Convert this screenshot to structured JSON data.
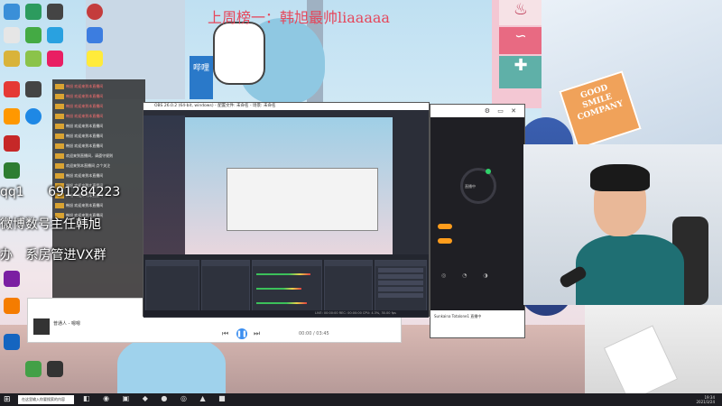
{
  "banner": "上周榜一：韩旭最帅liaaaaa",
  "overlay": {
    "qq_prefix": "qq1",
    "qq_number": "691284223",
    "wechat_line": "微博",
    "wechat_suffix": "数号主任韩旭",
    "office_line": "办",
    "office_suffix": "系房管进VX群"
  },
  "obs": {
    "title": "OBS 26.0.2 (64-bit, windows) - 配置文件: 未命名 - 场景: 未命名",
    "status": "LIVE: 00:00:00  REC: 00:00:00  CPU: 4.3%, 30.00 fps"
  },
  "tool": {
    "ring_label": "直播中",
    "footer_text": "Sunkaina  Totalone1 直播中"
  },
  "music": {
    "title": "普通人 - 嗯嗯",
    "time": "00:00 / 03:45"
  },
  "smile_sign": [
    "GOOD",
    "SMILE",
    "COMPANY"
  ],
  "signs": {
    "bili": "哔哩",
    "fan": "♨",
    "whale": "∽",
    "plus": "✚"
  },
  "taskbar": {
    "search_placeholder": "在这里输入你要搜索的内容",
    "start_glyph": "⊞",
    "icons": "◧ ◉ ▣ ◆ ● ◎ ▲ ■",
    "tray_line1": "19:34",
    "tray_line2": "2021/3/24"
  },
  "chat": {
    "lines": [
      {
        "text": "韩旭 欢迎来到本直播间",
        "red": true
      },
      {
        "text": "韩旭 欢迎来到本直播间",
        "red": true
      },
      {
        "text": "韩旭 欢迎来到本直播间",
        "red": true
      },
      {
        "text": "韩旭 欢迎来到本直播间",
        "red": true
      },
      {
        "text": "韩旭 欢迎来到本直播间",
        "red": false
      },
      {
        "text": "韩旭 欢迎来到本直播间",
        "red": false
      },
      {
        "text": "韩旭 欢迎来到本直播间",
        "red": false
      },
      {
        "text": "欢迎来到直播间，请遵守规则",
        "red": false
      },
      {
        "text": "欢迎来到本直播间 点个关注",
        "red": false
      },
      {
        "text": "韩旭 欢迎来到本直播间",
        "red": false
      },
      {
        "text": "韩旭 欢迎来到本直播间",
        "red": false
      },
      {
        "text": "韩旭 欢迎来到本直播间",
        "red": false
      },
      {
        "text": "韩旭 欢迎来到本直播间",
        "red": false
      },
      {
        "text": "韩旭 欢迎来到本直播间",
        "red": false
      }
    ]
  },
  "colors": {
    "banner": "#e5475b",
    "accent_orange": "#ff9d1c",
    "live_green": "#2fd36a",
    "obs_bg": "#2b2e38"
  }
}
